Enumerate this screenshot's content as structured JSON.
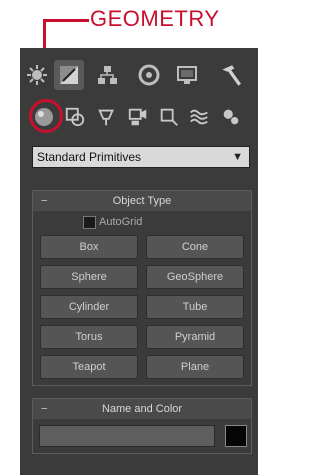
{
  "callout": {
    "label": "GEOMETRY",
    "color": "#c8102e"
  },
  "tabs": [
    {
      "name": "sun-icon",
      "selected": false
    },
    {
      "name": "modify-icon",
      "selected": true
    },
    {
      "name": "hierarchy-icon",
      "selected": false
    },
    {
      "name": "motion-icon",
      "selected": false
    },
    {
      "name": "display-icon",
      "selected": false
    },
    {
      "name": "utilities-hammer-icon",
      "selected": false
    }
  ],
  "subtabs": [
    {
      "name": "geometry-icon"
    },
    {
      "name": "shapes-icon"
    },
    {
      "name": "lights-icon"
    },
    {
      "name": "cameras-icon"
    },
    {
      "name": "helpers-icon"
    },
    {
      "name": "spacewarps-icon"
    },
    {
      "name": "systems-icon"
    }
  ],
  "dropdown": {
    "value": "Standard Primitives"
  },
  "object_type": {
    "title": "Object Type",
    "collapse": "−",
    "autogrid_label": "AutoGrid",
    "buttons": [
      "Box",
      "Cone",
      "Sphere",
      "GeoSphere",
      "Cylinder",
      "Tube",
      "Torus",
      "Pyramid",
      "Teapot",
      "Plane"
    ]
  },
  "name_and_color": {
    "title": "Name and Color",
    "collapse": "−",
    "name_value": "",
    "color": "#050505"
  }
}
